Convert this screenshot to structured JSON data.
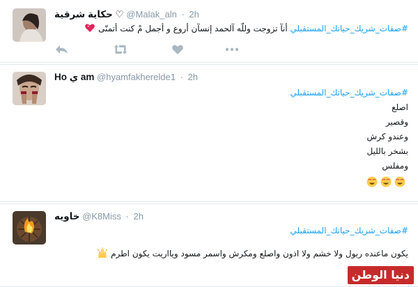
{
  "hashtag": "#صفات_شريك_حياتك_المستقبلي",
  "tweets": [
    {
      "name": "حكاية شرقية ♡",
      "handle": "@Malak_aln",
      "time": "2h",
      "hashtag": "#صفات_شريك_حياتك_المستقبلي",
      "text": "أنآ تزوجت وللّه آلحمد إنسآن أروع و أجمل مْ كنت أتمنّى"
    },
    {
      "name": "Ho ي am",
      "handle": "@hyamfakherelde1",
      "time": "2h",
      "hashtag": "#صفات_شريك_حياتك_المستقبلي",
      "lines": [
        "اصلع",
        "وقصير",
        "وعندو كرش",
        "بشخر بالليل",
        "ومفلس"
      ]
    },
    {
      "name": "خاويه",
      "handle": "@K8Miss",
      "time": "2h",
      "hashtag": "#صفات_شريك_حياتك_المستقبلي",
      "text": "يكون ماعنده ربول ولا خشم ولا اذون واصلع ومكرش واسمر مسود ويااريت يكون اطرم"
    }
  ],
  "separator": "·",
  "watermark": "دنيا الوطن",
  "colors": {
    "hashtag": "#1da1f2",
    "meta": "#8899a6",
    "border": "#e1e8ed",
    "watermark_bg": "#c62b2b"
  },
  "icons": [
    "reply-icon",
    "retweet-icon",
    "like-icon",
    "more-icon",
    "heart-emoji",
    "heart-eyes-emoji",
    "raised-hands-emoji"
  ]
}
